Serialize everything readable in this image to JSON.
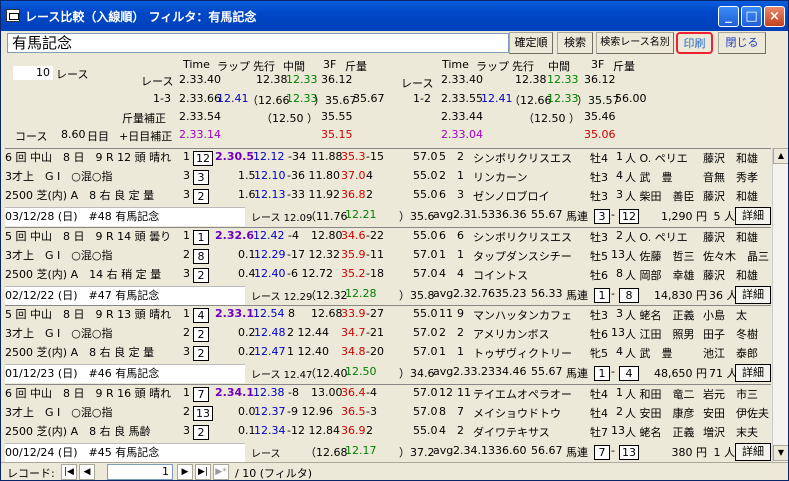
{
  "window": {
    "title": "レース比較（入線順） フィルタ：有馬記念",
    "min": "_",
    "max": "□",
    "close": "×"
  },
  "header": {
    "race_name": "有馬記念",
    "buttons": [
      "確定順",
      "検索",
      "検索レース名別",
      "印刷",
      "閉じる"
    ]
  },
  "summary": {
    "count": "10",
    "count_unit": "レース",
    "course_label": "コース",
    "day_val": "8.60",
    "day_unit": "日目",
    "day_adj": "+日目補正",
    "colhdr": [
      "Time",
      "ラップ",
      "先行",
      "中間",
      "3F",
      "斤量"
    ],
    "rows": [
      {
        "label": "レース",
        "time": "2.33.40",
        "lap": "",
        "sen": "12.38",
        "mid": "12.33",
        "f3": "36.12",
        "kin": ""
      },
      {
        "label": "1-3",
        "time": "2.33.66",
        "lap": "12.41",
        "sen": "（12.66",
        "mid": "12.33",
        "f3": "）35.67",
        "kin": "35.67"
      },
      {
        "label": "斤量補正",
        "time": "2.33.54",
        "lap": "",
        "sen": "（12.50 ）",
        "mid": "",
        "f3": "35.55",
        "kin": ""
      },
      {
        "label": "",
        "time": "2.33.14",
        "lap": "",
        "sen": "",
        "mid": "",
        "f3": "35.15",
        "kin": ""
      }
    ],
    "rows2": [
      {
        "label": "レース",
        "time": "2.33.40",
        "lap": "",
        "sen": "12.38",
        "mid": "12.33",
        "f3": "36.12",
        "kin": ""
      },
      {
        "label": "1-2",
        "time": "2.33.55",
        "lap": "12.41",
        "sen": "（12.66",
        "mid": "12.33",
        "f3": "）35.57",
        "kin": "56.00"
      },
      {
        "label": "",
        "time": "2.33.44",
        "lap": "",
        "sen": "（12.50 ）",
        "mid": "",
        "f3": "35.46",
        "kin": ""
      },
      {
        "label": "",
        "time": "2.33.04",
        "lap": "",
        "sen": "",
        "mid": "",
        "f3": "35.06",
        "kin": ""
      }
    ]
  },
  "races": [
    {
      "info": [
        "6 回 中山　8 日　9 R 12 頭 晴れ",
        "3才上　G Ⅰ　○混○指",
        "2500 芝(内) A　8 右 良 定 量",
        "03/12/28 (日)　#48 有馬記念"
      ],
      "runners": [
        {
          "ord": "1",
          "box": "12",
          "time": "2.30.5",
          "lap": "12.12",
          "d": "-34",
          "s": "11.88",
          "m": "35.3",
          "n": "-15",
          "kin": "57.0",
          "w": "5",
          "u": "2",
          "name": "シンボリクリスエス",
          "sex": "牡4",
          "pop": "1",
          "jock": "人 O. ペリエ",
          "trainer": "藤沢　和雄"
        },
        {
          "ord": "3",
          "box": "3",
          "time": "",
          "lap": "1.5",
          "d": "12.10",
          "s": "-36 11.80",
          "m": "37.0",
          "n": "4",
          "kin": "55.0",
          "w": "2",
          "u": "1",
          "name": "リンカーン",
          "sex": "牡3",
          "pop": "4",
          "jock": "人 武　豊",
          "trainer": "音無　秀孝"
        },
        {
          "ord": "3",
          "box": "2",
          "time": "",
          "lap": "1.6",
          "d": "12.13",
          "s": "-33 11.92",
          "m": "36.8",
          "n": "2",
          "kin": "55.0",
          "w": "6",
          "u": "3",
          "name": "ゼンノロブロイ",
          "sex": "牡3",
          "pop": "3",
          "jock": "人 柴田　善臣",
          "trainer": "藤沢　和雄"
        }
      ],
      "foot": {
        "race": "レース 12.09",
        "sen": "（11.76",
        "mid": "12.21",
        "f3": "）35.6",
        "avg": "avg",
        "at": "2.31.53",
        "a1": "36.36",
        "a2": "55.67",
        "bl": "馬連",
        "b1": "3",
        "b2": "12",
        "pay": "1,290 円",
        "pop": "5 人",
        "btn": "詳細"
      }
    },
    {
      "info": [
        "5 回 中山　8 日　9 R 14 頭 曇り",
        "3才上　G Ⅰ　○混○指",
        "2500 芝(内) A　14 右 稍 定 量",
        "02/12/22 (日)　#47 有馬記念"
      ],
      "runners": [
        {
          "ord": "1",
          "box": "1",
          "time": "2.32.6",
          "lap": "12.42",
          "d": "-4",
          "s": "12.80",
          "m": "34.6",
          "n": "-22",
          "kin": "55.0",
          "w": "6",
          "u": "6",
          "name": "シンボリクリスエス",
          "sex": "牡3",
          "pop": "2",
          "jock": "人 O. ペリエ",
          "trainer": "藤沢　和雄"
        },
        {
          "ord": "2",
          "box": "8",
          "time": "",
          "lap": "0.1",
          "d": "12.29",
          "s": "-17 12.32",
          "m": "35.9",
          "n": "-11",
          "kin": "57.0",
          "w": "1",
          "u": "1",
          "name": "タップダンスシチー",
          "sex": "牡5",
          "pop": "13",
          "jock": "人 佐藤　哲三",
          "trainer": "佐々木　晶三"
        },
        {
          "ord": "3",
          "box": "2",
          "time": "",
          "lap": "0.4",
          "d": "12.40",
          "s": "-6 12.72",
          "m": "35.2",
          "n": "-18",
          "kin": "57.0",
          "w": "4",
          "u": "4",
          "name": "コイントス",
          "sex": "牡6",
          "pop": "8",
          "jock": "人 岡部　幸雄",
          "trainer": "藤沢　和雄"
        }
      ],
      "foot": {
        "race": "レース 12.29",
        "sen": "（12.32",
        "mid": "12.28",
        "f3": "）35.8",
        "avg": "avg",
        "at": "2.32.76",
        "a1": "35.23",
        "a2": "56.33",
        "bl": "馬連",
        "b1": "1",
        "b2": "8",
        "pay": "14,830 円",
        "pop": "36 人",
        "btn": "詳細"
      }
    },
    {
      "info": [
        "5 回 中山　8 日　9 R 13 頭 晴れ",
        "3才上　G Ⅰ　○混○指",
        "2500 芝(内) A　8 右 良 定 量",
        "01/12/23 (日)　#46 有馬記念"
      ],
      "runners": [
        {
          "ord": "1",
          "box": "4",
          "time": "2.33.1",
          "lap": "12.54",
          "d": "8",
          "s": "12.68",
          "m": "33.9",
          "n": "-27",
          "kin": "55.0",
          "w": "11",
          "u": "9",
          "name": "マンハッタンカフェ",
          "sex": "牡3",
          "pop": "3",
          "jock": "人 蛯名　正義",
          "trainer": "小島　太"
        },
        {
          "ord": "2",
          "box": "2",
          "time": "",
          "lap": "0.2",
          "d": "12.48",
          "s": "2 12.44",
          "m": "34.7",
          "n": "-21",
          "kin": "57.0",
          "w": "2",
          "u": "2",
          "name": "アメリカンボス",
          "sex": "牡6",
          "pop": "13",
          "jock": "人 江田　照男",
          "trainer": "田子　冬樹"
        },
        {
          "ord": "3",
          "box": "2",
          "time": "",
          "lap": "0.2",
          "d": "12.47",
          "s": "1 12.40",
          "m": "34.8",
          "n": "-20",
          "kin": "57.0",
          "w": "1",
          "u": "1",
          "name": "トゥザヴィクトリー",
          "sex": "牝5",
          "pop": "4",
          "jock": "人 武　豊",
          "trainer": "池江　泰郎"
        }
      ],
      "foot": {
        "race": "レース 12.47",
        "sen": "（12.40",
        "mid": "12.50",
        "f3": "）34.6",
        "avg": "avg",
        "at": "2.33.23",
        "a1": "34.46",
        "a2": "55.67",
        "bl": "馬連",
        "b1": "1",
        "b2": "4",
        "pay": "48,650 円",
        "pop": "71 人",
        "btn": "詳細"
      }
    },
    {
      "info": [
        "6 回 中山　8 日　9 R 16 頭 晴れ",
        "3才上　G Ⅰ　○混○指",
        "2500 芝(内) A　8 右 良 馬齢",
        "00/12/24 (日)　#45 有馬記念"
      ],
      "runners": [
        {
          "ord": "1",
          "box": "7",
          "time": "2.34.1",
          "lap": "12.38",
          "d": "-8",
          "s": "13.00",
          "m": "36.4",
          "n": "-4",
          "kin": "57.0",
          "w": "12",
          "u": "11",
          "name": "テイエムオペラオー",
          "sex": "牡4",
          "pop": "1",
          "jock": "人 和田　竜二",
          "trainer": "岩元　市三"
        },
        {
          "ord": "2",
          "box": "13",
          "time": "",
          "lap": "0.0",
          "d": "12.37",
          "s": "-9 12.96",
          "m": "36.5",
          "n": "-3",
          "kin": "57.0",
          "w": "8",
          "u": "7",
          "name": "メイショウドトウ",
          "sex": "牡4",
          "pop": "2",
          "jock": "人 安田　康彦",
          "trainer": "安田　伊佐夫"
        },
        {
          "ord": "3",
          "box": "2",
          "time": "",
          "lap": "0.1",
          "d": "12.34",
          "s": "-12 12.84",
          "m": "36.9",
          "n": "2",
          "kin": "55.0",
          "w": "4",
          "u": "2",
          "name": "ダイワテキサス",
          "sex": "牡7",
          "pop": "13",
          "jock": "人 蛯名　正義",
          "trainer": "増沢　末夫"
        }
      ],
      "foot": {
        "race": "レース",
        "sen": "（12.68",
        "mid": "12.17",
        "f3": "）37.2",
        "avg": "avg",
        "at": "2.34.13",
        "a1": "36.60",
        "a2": "56.67",
        "bl": "馬連",
        "b1": "7",
        "b2": "13",
        "pay": "380 円",
        "pop": "1 人",
        "btn": "詳細"
      }
    }
  ],
  "statusbar": {
    "record_label": "レコード:",
    "current": "1",
    "total": "/ 10 (フィルタ)"
  }
}
